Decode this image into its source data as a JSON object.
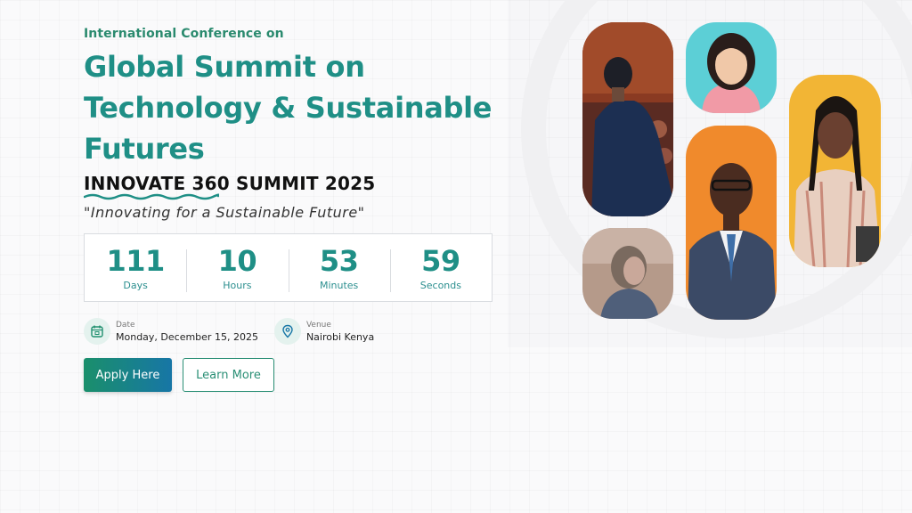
{
  "hero": {
    "eyebrow": "International Conference on",
    "title_lines": [
      "Global Summit on",
      "Technology & Sustainable",
      "Futures"
    ],
    "subtitle": "INNOVATE 360 SUMMIT 2025",
    "tagline": "\"Innovating for a Sustainable Future\""
  },
  "countdown": [
    {
      "value": "111",
      "label": "Days"
    },
    {
      "value": "10",
      "label": "Hours"
    },
    {
      "value": "53",
      "label": "Minutes"
    },
    {
      "value": "59",
      "label": "Seconds"
    }
  ],
  "meta": {
    "date": {
      "label": "Date",
      "value": "Monday, December 15, 2025",
      "icon": "calendar-icon"
    },
    "venue": {
      "label": "Venue",
      "value": "Nairobi Kenya",
      "icon": "location-pin-icon"
    }
  },
  "actions": {
    "apply_label": "Apply Here",
    "learn_label": "Learn More"
  },
  "colors": {
    "accent_green": "#1f8f86",
    "accent_blue": "#1776a6",
    "photo_orange": "#f08a2c",
    "photo_yellow": "#f2b535",
    "photo_cyan": "#5ccfd6"
  }
}
